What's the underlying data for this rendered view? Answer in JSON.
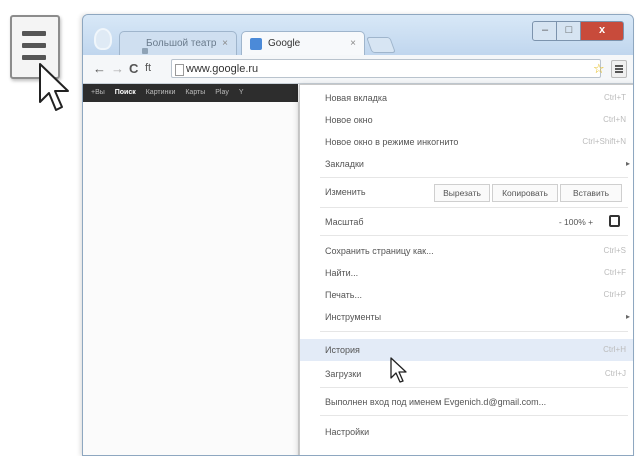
{
  "tabs": [
    {
      "label": "Большой театр",
      "active": false
    },
    {
      "label": "Google",
      "active": true
    }
  ],
  "window_controls": {
    "minimize": "–",
    "maximize": "□",
    "close": "x"
  },
  "toolbar": {
    "back": "←",
    "forward": "→",
    "reload": "C",
    "home": "ft",
    "url": "www.google.ru"
  },
  "google_bar": [
    {
      "label": "+Вы",
      "on": false
    },
    {
      "label": "Поиск",
      "on": true
    },
    {
      "label": "Картинки",
      "on": false
    },
    {
      "label": "Карты",
      "on": false
    },
    {
      "label": "Play",
      "on": false
    },
    {
      "label": "Y",
      "on": false
    }
  ],
  "menu": {
    "new_tab": {
      "label": "Новая вкладка",
      "shortcut": "Ctrl+T"
    },
    "new_window": {
      "label": "Новое окно",
      "shortcut": "Ctrl+N"
    },
    "incognito": {
      "label": "Новое окно в режиме инкогнито",
      "shortcut": "Ctrl+Shift+N"
    },
    "bookmarks": {
      "label": "Закладки",
      "arrow": "▸"
    },
    "edit": {
      "label": "Изменить",
      "cut": "Вырезать",
      "copy": "Копировать",
      "paste": "Вставить"
    },
    "zoom": {
      "label": "Масштаб",
      "value": "-  100%  +"
    },
    "save_page": {
      "label": "Сохранить страницу как...",
      "shortcut": "Ctrl+S"
    },
    "find": {
      "label": "Найти...",
      "shortcut": "Ctrl+F"
    },
    "print": {
      "label": "Печать...",
      "shortcut": "Ctrl+P"
    },
    "tools": {
      "label": "Инструменты",
      "arrow": "▸"
    },
    "history": {
      "label": "История",
      "shortcut": "Ctrl+H"
    },
    "downloads": {
      "label": "Загрузки",
      "shortcut": "Ctrl+J"
    },
    "signed_in": {
      "label": "Выполнен вход под именем Evgenich.d@gmail.com..."
    },
    "settings": {
      "label": "Настройки"
    }
  },
  "colors": {
    "menu_highlight": "#e3ebf7",
    "close_button": "#c84b3b",
    "star": "#e3b70d"
  }
}
